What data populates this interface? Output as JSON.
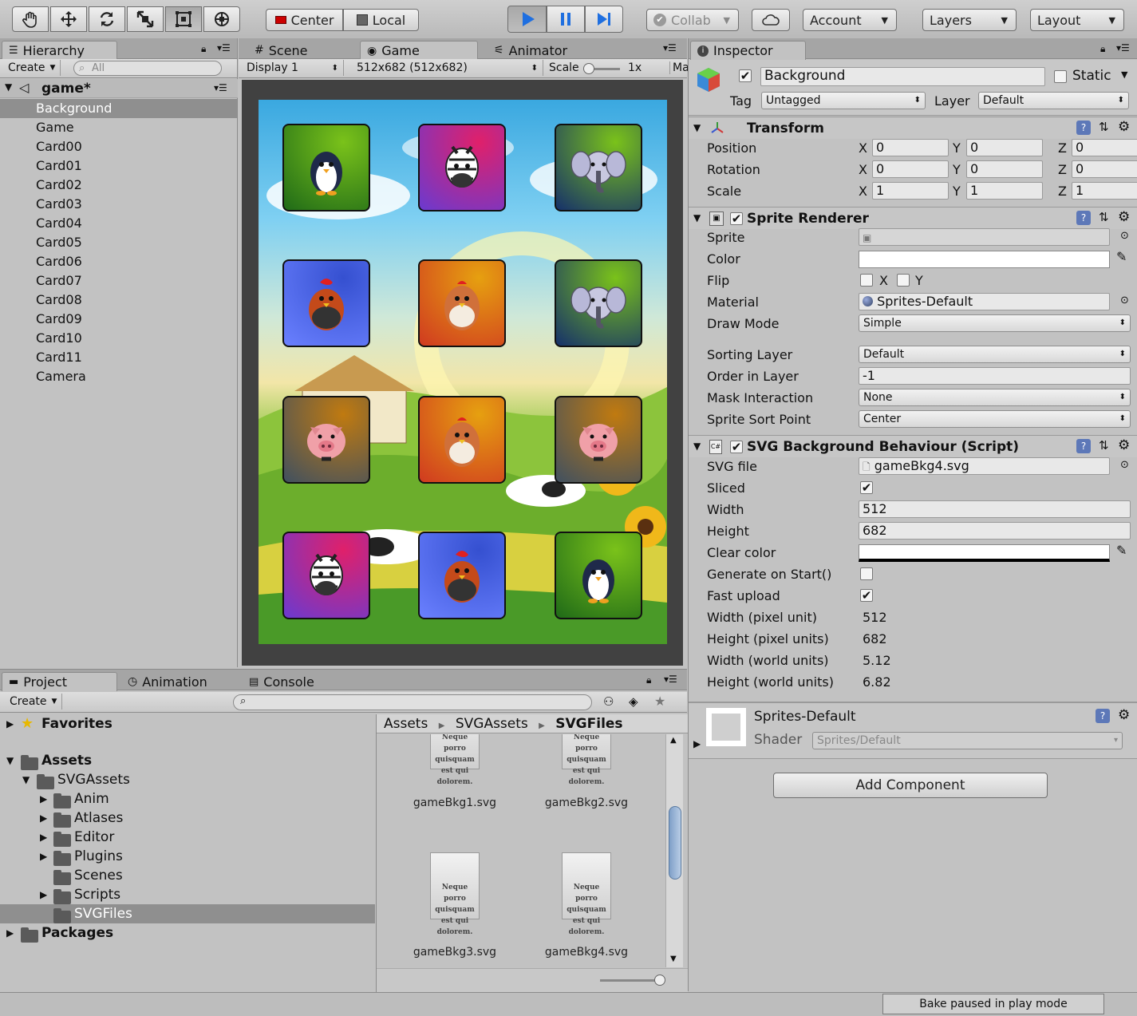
{
  "toolbar": {
    "tools": [
      "hand-tool-icon",
      "move-tool-icon",
      "rotate-tool-icon",
      "scale-tool-icon",
      "rect-tool-icon",
      "transform-tool-icon"
    ],
    "pivot": "Center",
    "space": "Local",
    "collab": "Collab",
    "account": "Account",
    "layers": "Layers",
    "layout": "Layout"
  },
  "hierarchy": {
    "tab": "Hierarchy",
    "create": "Create",
    "search_placeholder": "All",
    "scene": "game*",
    "items": [
      "Background",
      "Game",
      "Card00",
      "Card01",
      "Card02",
      "Card03",
      "Card04",
      "Card05",
      "Card06",
      "Card07",
      "Card08",
      "Card09",
      "Card10",
      "Card11",
      "Camera"
    ],
    "selected": "Background"
  },
  "center": {
    "tabs": [
      "Scene",
      "Game",
      "Animator"
    ],
    "display": "Display 1",
    "resolution": "512x682 (512x682)",
    "scale_label": "Scale",
    "scale_value": "1x",
    "extra": "Ma"
  },
  "game_view": {
    "cards": [
      "penguin",
      "zebra",
      "elephant",
      "rooster",
      "hen",
      "elephant",
      "pig",
      "hen",
      "pig",
      "zebra",
      "rooster",
      "penguin"
    ],
    "card_colors": [
      [
        "#7ac21a",
        "#1f6a18"
      ],
      [
        "#e0206a",
        "#6a3ad0"
      ],
      [
        "#7ac21a",
        "#15306a"
      ],
      [
        "#3550d0",
        "#6a80ff"
      ],
      [
        "#e6a010",
        "#d03a20"
      ],
      [
        "#7ac21a",
        "#15306a"
      ],
      [
        "#c07a10",
        "#405060"
      ],
      [
        "#e6a010",
        "#d03a20"
      ],
      [
        "#c07a10",
        "#405060"
      ],
      [
        "#e0206a",
        "#6a3ad0"
      ],
      [
        "#3550d0",
        "#6a80ff"
      ],
      [
        "#7ac21a",
        "#1f6a18"
      ]
    ]
  },
  "inspector": {
    "tab": "Inspector",
    "object_name": "Background",
    "static": "Static",
    "tag_label": "Tag",
    "tag_value": "Untagged",
    "layer_label": "Layer",
    "layer_value": "Default",
    "transform": {
      "title": "Transform",
      "rows": [
        {
          "label": "Position",
          "x": "0",
          "y": "0",
          "z": "0"
        },
        {
          "label": "Rotation",
          "x": "0",
          "y": "0",
          "z": "0"
        },
        {
          "label": "Scale",
          "x": "1",
          "y": "1",
          "z": "1"
        }
      ],
      "axis": [
        "X",
        "Y",
        "Z"
      ]
    },
    "sprite_renderer": {
      "title": "Sprite Renderer",
      "sprite_label": "Sprite",
      "color_label": "Color",
      "flip_label": "Flip",
      "flip_x": "X",
      "flip_y": "Y",
      "material_label": "Material",
      "material_value": "Sprites-Default",
      "draw_mode_label": "Draw Mode",
      "draw_mode_value": "Simple",
      "sorting_layer_label": "Sorting Layer",
      "sorting_layer_value": "Default",
      "order_label": "Order in Layer",
      "order_value": "-1",
      "mask_label": "Mask Interaction",
      "mask_value": "None",
      "sort_point_label": "Sprite Sort Point",
      "sort_point_value": "Center"
    },
    "svg_behaviour": {
      "title": "SVG Background Behaviour (Script)",
      "svg_file_label": "SVG file",
      "svg_file_value": "gameBkg4.svg",
      "sliced_label": "Sliced",
      "width_label": "Width",
      "width_value": "512",
      "height_label": "Height",
      "height_value": "682",
      "clear_color_label": "Clear color",
      "generate_label": "Generate on Start()",
      "fast_upload_label": "Fast upload",
      "wpu_label": "Width (pixel unit)",
      "wpu_value": "512",
      "hpu_label": "Height (pixel units)",
      "hpu_value": "682",
      "wwu_label": "Width (world units)",
      "wwu_value": "5.12",
      "hwu_label": "Height (world units)",
      "hwu_value": "6.82"
    },
    "material": {
      "name": "Sprites-Default",
      "shader_label": "Shader",
      "shader_value": "Sprites/Default"
    },
    "add_component": "Add Component"
  },
  "project": {
    "tabs": [
      "Project",
      "Animation",
      "Console"
    ],
    "create": "Create",
    "favorites": "Favorites",
    "assets": "Assets",
    "svgassets": "SVGAssets",
    "folders": [
      "Anim",
      "Atlases",
      "Editor",
      "Plugins",
      "Scenes",
      "Scripts",
      "SVGFiles"
    ],
    "packages": "Packages",
    "breadcrumb": [
      "Assets",
      "SVGAssets",
      "SVGFiles"
    ],
    "files": [
      "gameBkg1.svg",
      "gameBkg2.svg",
      "gameBkg3.svg",
      "gameBkg4.svg"
    ],
    "thumb_text": "Neque porro quisquam est qui dolorem."
  },
  "status": {
    "bake": "Bake paused in play mode"
  }
}
